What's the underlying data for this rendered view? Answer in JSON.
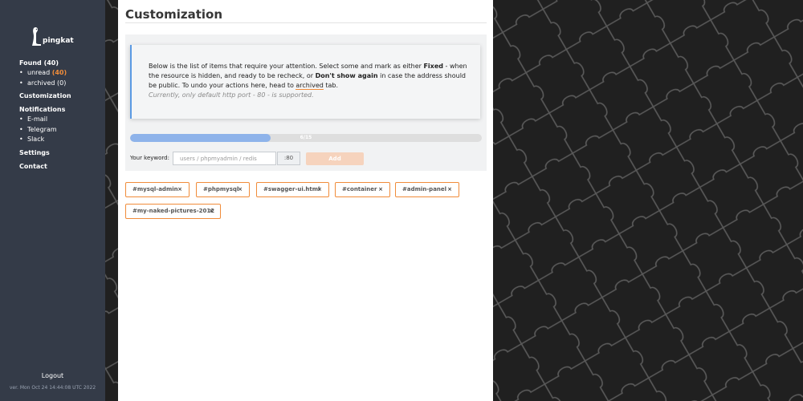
{
  "app": {
    "name": "pingkat"
  },
  "sidebar": {
    "found_label": "Found",
    "found_count": "(40)",
    "unread_label": "unread",
    "unread_count": "(40)",
    "archived_label": "archived",
    "archived_count": "(0)",
    "customization": "Customization",
    "notifications": "Notifications",
    "notify_items": [
      "E-mail",
      "Telegram",
      "Slack"
    ],
    "settings": "Settings",
    "contact": "Contact",
    "logout": "Logout",
    "version": "ver. Mon Oct 24 14:44:08 UTC 2022"
  },
  "page": {
    "title": "Customization",
    "note_1a": "Below is the list of items that require your attention. Select some and mark as either ",
    "note_fixed": "Fixed",
    "note_1b": " - when the resource is hidden, and ready to be recheck, or ",
    "note_dont": "Don't show again",
    "note_1c": " in case the address should be public. To undo your actions here, head to ",
    "note_link": "archived",
    "note_1d": " tab.",
    "note_hint": "Currently, only default http port - 80 - is supported.",
    "progress_text": "6/15",
    "progress_value": 0.4,
    "keyword_label": "Your keyword:",
    "keyword_placeholder": "users / phpmyadmin / redis",
    "port": ":80",
    "add_label": "Add"
  },
  "tags": [
    {
      "label": "#mysql-admin",
      "remove": "×"
    },
    {
      "label": "#phpmysql",
      "remove": "×"
    },
    {
      "label": "#swagger-ui.html",
      "remove": "×"
    },
    {
      "label": "#container",
      "remove": "×"
    },
    {
      "label": "#admin-panel",
      "remove": "×"
    },
    {
      "label": "#my-naked-pictures-2012",
      "remove": "×"
    }
  ],
  "colors": {
    "sidebar": "#343b48",
    "accent": "#f08c3a",
    "progress": "#8eb3ea",
    "note_border": "#5b9ae3"
  }
}
